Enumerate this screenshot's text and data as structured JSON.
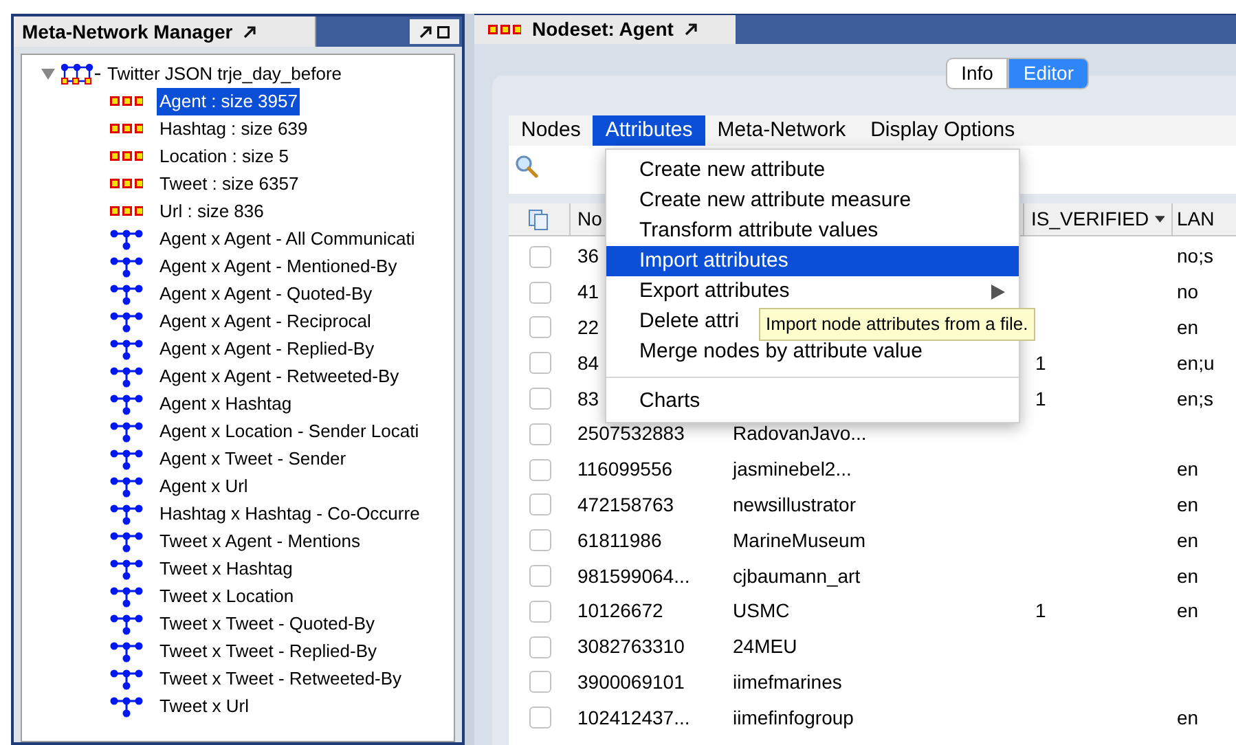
{
  "left_panel": {
    "title": "Meta-Network Manager",
    "tree": {
      "label": "Twitter JSON trje_day_before",
      "expanded": true,
      "children": [
        {
          "label": "Agent : size 3957",
          "kind": "nodeset",
          "selected": true
        },
        {
          "label": "Hashtag : size 639",
          "kind": "nodeset",
          "selected": false
        },
        {
          "label": "Location : size 5",
          "kind": "nodeset",
          "selected": false
        },
        {
          "label": "Tweet : size 6357",
          "kind": "nodeset",
          "selected": false
        },
        {
          "label": "Url : size 836",
          "kind": "nodeset",
          "selected": false
        },
        {
          "label": "Agent x Agent - All Communicati",
          "kind": "network",
          "selected": false
        },
        {
          "label": "Agent x Agent - Mentioned-By",
          "kind": "network",
          "selected": false
        },
        {
          "label": "Agent x Agent - Quoted-By",
          "kind": "network",
          "selected": false
        },
        {
          "label": "Agent x Agent - Reciprocal",
          "kind": "network",
          "selected": false
        },
        {
          "label": "Agent x Agent - Replied-By",
          "kind": "network",
          "selected": false
        },
        {
          "label": "Agent x Agent - Retweeted-By",
          "kind": "network",
          "selected": false
        },
        {
          "label": "Agent x Hashtag",
          "kind": "network",
          "selected": false
        },
        {
          "label": "Agent x Location - Sender Locati",
          "kind": "network",
          "selected": false
        },
        {
          "label": "Agent x Tweet - Sender",
          "kind": "network",
          "selected": false
        },
        {
          "label": "Agent x Url",
          "kind": "network",
          "selected": false
        },
        {
          "label": "Hashtag x Hashtag - Co-Occurre",
          "kind": "network",
          "selected": false
        },
        {
          "label": "Tweet x Agent - Mentions",
          "kind": "network",
          "selected": false
        },
        {
          "label": "Tweet x Hashtag",
          "kind": "network",
          "selected": false
        },
        {
          "label": "Tweet x Location",
          "kind": "network",
          "selected": false
        },
        {
          "label": "Tweet x Tweet - Quoted-By",
          "kind": "network",
          "selected": false
        },
        {
          "label": "Tweet x Tweet - Replied-By",
          "kind": "network",
          "selected": false
        },
        {
          "label": "Tweet x Tweet - Retweeted-By",
          "kind": "network",
          "selected": false
        },
        {
          "label": "Tweet x Url",
          "kind": "network",
          "selected": false
        }
      ]
    }
  },
  "editor": {
    "tab": "Nodeset: Agent",
    "view_tabs": [
      {
        "label": "Info",
        "selected": false
      },
      {
        "label": "Editor",
        "selected": true
      }
    ],
    "menus": [
      {
        "label": "Nodes",
        "selected": false
      },
      {
        "label": "Attributes",
        "selected": true
      },
      {
        "label": "Meta-Network",
        "selected": false
      },
      {
        "label": "Display Options",
        "selected": false
      }
    ],
    "dropdown": [
      {
        "kind": "item",
        "label": "Create new attribute",
        "selected": false
      },
      {
        "kind": "item",
        "label": "Create new attribute measure",
        "selected": false
      },
      {
        "kind": "item",
        "label": "Transform attribute values",
        "selected": false
      },
      {
        "kind": "item",
        "label": "Import attributes",
        "selected": true
      },
      {
        "kind": "item",
        "label": "Export attributes",
        "selected": false,
        "submenu": true
      },
      {
        "kind": "item",
        "label": "Delete attri",
        "selected": false
      },
      {
        "kind": "item",
        "label": "Merge nodes by attribute value",
        "selected": false
      },
      {
        "kind": "separator"
      },
      {
        "kind": "item",
        "label": "Charts",
        "selected": false
      }
    ],
    "tooltip": "Import node attributes from a file.",
    "table": {
      "columns": [
        {
          "label": "No"
        },
        {
          "label": "IS_VERIFIED",
          "has_menu": true
        },
        {
          "label": "LAN"
        }
      ],
      "rows": [
        {
          "checked": false,
          "id": "36",
          "lang": "no;s"
        },
        {
          "checked": false,
          "id": "41",
          "lang": "no"
        },
        {
          "checked": false,
          "id": "22",
          "lang": "en"
        },
        {
          "checked": false,
          "id": "84",
          "verified": "1",
          "lang": "en;u"
        },
        {
          "checked": false,
          "id": "83",
          "verified": "1",
          "lang": "en;s"
        },
        {
          "checked": false,
          "id": "2507532883",
          "name": "RadovanJavo..."
        },
        {
          "checked": false,
          "id": "116099556",
          "name": "jasminebel2...",
          "lang": "en"
        },
        {
          "checked": false,
          "id": "472158763",
          "name": "newsillustrator",
          "lang": "en"
        },
        {
          "checked": false,
          "id": "61811986",
          "name": "MarineMuseum",
          "lang": "en"
        },
        {
          "checked": false,
          "id": "981599064...",
          "name": "cjbaumann_art",
          "lang": "en"
        },
        {
          "checked": false,
          "id": "10126672",
          "name": "USMC",
          "verified": "1",
          "lang": "en"
        },
        {
          "checked": false,
          "id": "3082763310",
          "name": "24MEU"
        },
        {
          "checked": false,
          "id": "3900069101",
          "name": "iimefmarines"
        },
        {
          "checked": false,
          "id": "102412437...",
          "name": "iimefinfogroup",
          "lang": "en"
        }
      ]
    }
  }
}
